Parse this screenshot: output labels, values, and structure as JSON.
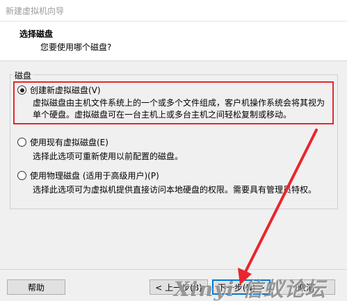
{
  "window": {
    "title": "新建虚拟机向导"
  },
  "header": {
    "title": "选择磁盘",
    "subtitle": "您要使用哪个磁盘?"
  },
  "disk_group": {
    "label": "磁盘",
    "options": [
      {
        "label": "创建新虚拟磁盘(V)",
        "checked": true,
        "desc_line1": "虚拟磁盘由主机文件系统上的一个或多个文件组成，客户机操作系统会将其视为",
        "desc_line2": "单个硬盘。虚拟磁盘可在一台主机上或多台主机之间轻松复制或移动。"
      },
      {
        "label": "使用现有虚拟磁盘(E)",
        "checked": false,
        "desc_line1": "选择此选项可重新使用以前配置的磁盘。"
      },
      {
        "label": "使用物理磁盘 (适用于高级用户)(P)",
        "checked": false,
        "desc_line1": "选择此选项可为虚拟机提供直接访问本地硬盘的权限。需要具有管理员特权。"
      }
    ]
  },
  "buttons": {
    "help": "帮助",
    "back": "< 上一步(B)",
    "next": "下一步(N) >",
    "cancel": "取消"
  },
  "watermark": {
    "text": "Xinyi 信蚁论坛"
  },
  "colors": {
    "highlight": "#e8262c",
    "arrow": "#e8262c"
  }
}
